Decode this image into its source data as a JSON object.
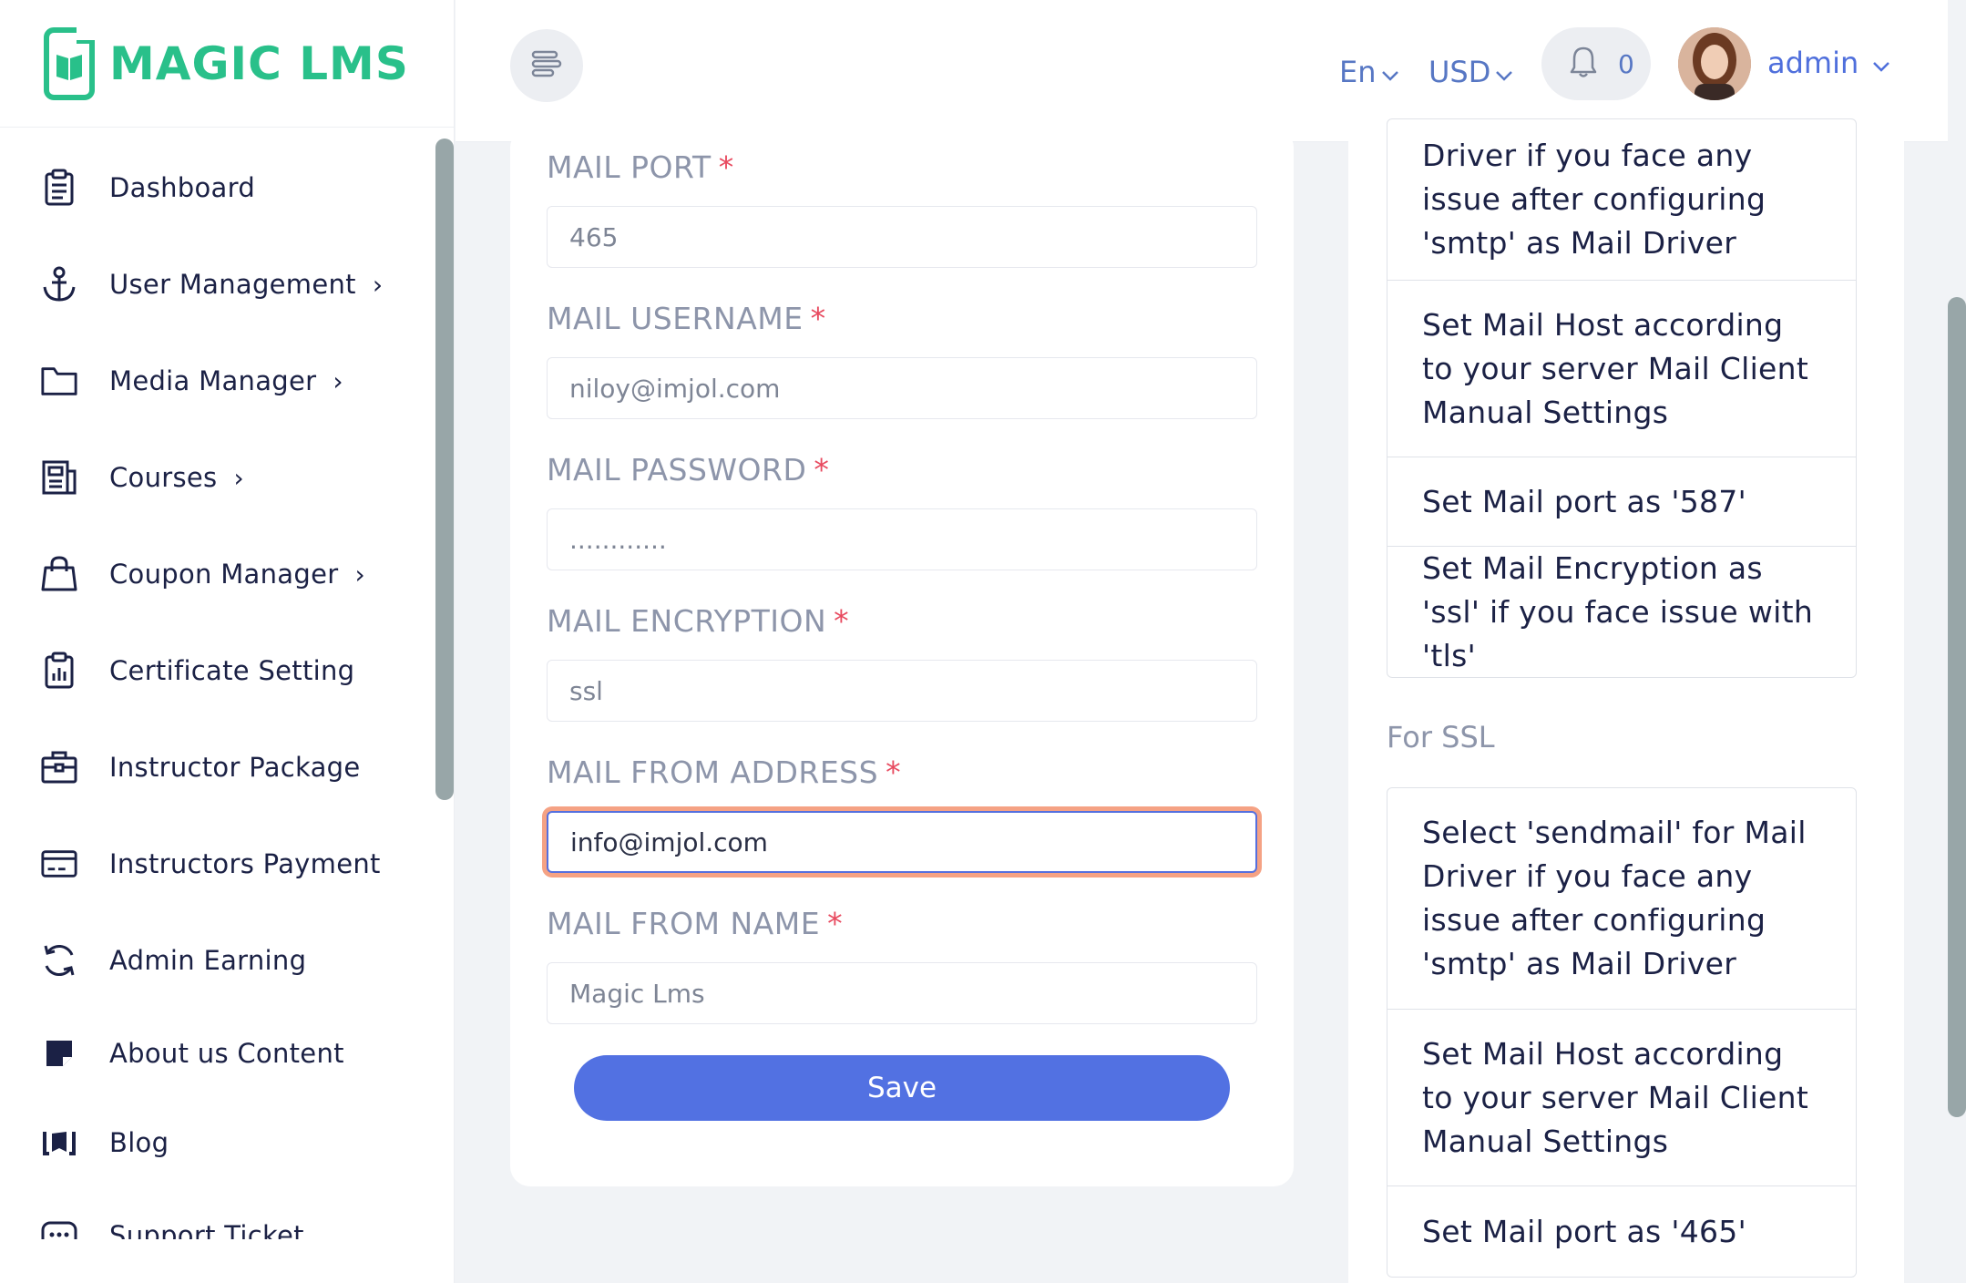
{
  "brand": {
    "name": "MAGIC LMS"
  },
  "sidebar": {
    "items": [
      {
        "label": "Dashboard",
        "icon": "clipboard-icon",
        "has_submenu": false
      },
      {
        "label": "User Management",
        "icon": "anchor-icon",
        "has_submenu": true
      },
      {
        "label": "Media Manager",
        "icon": "folder-icon",
        "has_submenu": true
      },
      {
        "label": "Courses",
        "icon": "newspaper-icon",
        "has_submenu": true
      },
      {
        "label": "Coupon Manager",
        "icon": "shopping-bag-icon",
        "has_submenu": true
      },
      {
        "label": "Certificate Setting",
        "icon": "chart-clipboard-icon",
        "has_submenu": false
      },
      {
        "label": "Instructor Package",
        "icon": "briefcase-icon",
        "has_submenu": false
      },
      {
        "label": "Instructors Payment",
        "icon": "credit-card-icon",
        "has_submenu": false
      },
      {
        "label": "Admin Earning",
        "icon": "refresh-icon",
        "has_submenu": false
      },
      {
        "label": "About us Content",
        "icon": "sticky-note-icon",
        "has_submenu": false
      },
      {
        "label": "Blog",
        "icon": "blog-icon",
        "has_submenu": false
      },
      {
        "label": "Support Ticket",
        "icon": "chat-icon",
        "has_submenu": false
      }
    ],
    "chevron": "›"
  },
  "header": {
    "language": "En",
    "currency": "USD",
    "notification_count": "0",
    "user_name": "admin"
  },
  "form": {
    "fields": [
      {
        "label": "MAIL PORT",
        "value": "465"
      },
      {
        "label": "MAIL USERNAME",
        "value": "niloy@imjol.com"
      },
      {
        "label": "MAIL PASSWORD",
        "value": "............"
      },
      {
        "label": "MAIL ENCRYPTION",
        "value": "ssl"
      },
      {
        "label": "MAIL FROM ADDRESS",
        "value": "info@imjol.com"
      },
      {
        "label": "MAIL FROM NAME",
        "value": "Magic Lms"
      }
    ],
    "required_mark": "*",
    "save_label": "Save"
  },
  "guide": {
    "box1": [
      "Driver if you face any issue after configuring 'smtp' as Mail Driver",
      "Set Mail Host according to your server Mail Client Manual Settings",
      "Set Mail port as '587'",
      "Set Mail Encryption as 'ssl' if you face issue with 'tls'"
    ],
    "ssl_title": "For SSL",
    "box2": [
      "Select 'sendmail' for Mail Driver if you face any issue after configuring 'smtp' as Mail Driver",
      "Set Mail Host according to your server Mail Client Manual Settings",
      "Set Mail port as '465'"
    ]
  },
  "colors": {
    "brand": "#29c08a",
    "primary": "#5271e2",
    "link": "#5777c4",
    "required": "#e84a5f",
    "focus_ring": "#f5a284"
  }
}
